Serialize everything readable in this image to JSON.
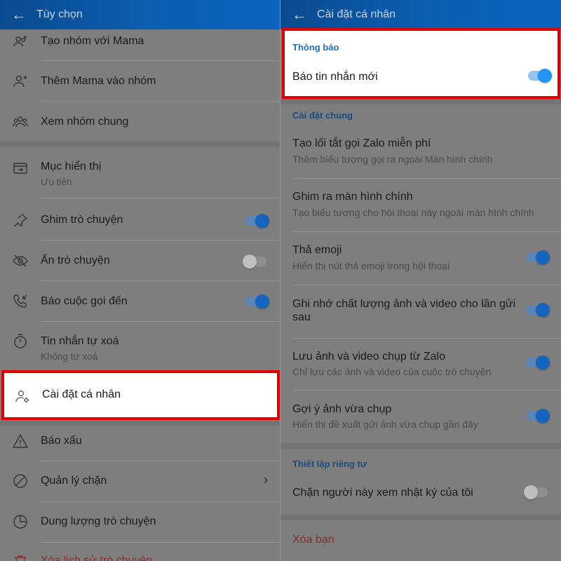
{
  "left": {
    "header": {
      "back_icon": "arrow-left-icon",
      "title": "Tùy chọn"
    },
    "items": {
      "create_group": {
        "label": "Tạo nhóm với Mama",
        "icon": "group-add-icon"
      },
      "add_to_group": {
        "label": "Thêm Mama vào nhóm",
        "icon": "person-add-icon"
      },
      "common_groups": {
        "label": "Xem nhóm chung",
        "icon": "group-icon"
      },
      "display_category": {
        "label": "Mục hiển thị",
        "sub": "Ưu tiên",
        "icon": "folder-arrow-icon"
      },
      "pin_chat": {
        "label": "Ghim trò chuyện",
        "icon": "pin-icon",
        "toggle": true
      },
      "hide_chat": {
        "label": "Ẩn trò chuyện",
        "icon": "eye-off-icon",
        "toggle": false
      },
      "incoming_call": {
        "label": "Báo cuộc gọi đến",
        "icon": "phone-incoming-icon",
        "toggle": true
      },
      "self_delete": {
        "label": "Tin nhắn tự xoá",
        "sub": "Không tự xoá",
        "icon": "timer-icon"
      },
      "personal_settings": {
        "label": "Cài đặt cá nhân",
        "icon": "user-settings-icon"
      },
      "report": {
        "label": "Báo xấu",
        "icon": "warning-icon"
      },
      "block_manage": {
        "label": "Quản lý chặn",
        "icon": "block-icon"
      },
      "storage": {
        "label": "Dung lượng trò chuyện",
        "icon": "pie-chart-icon"
      },
      "clear_history": {
        "label": "Xóa lịch sử trò chuyện",
        "icon": "trash-icon"
      }
    }
  },
  "right": {
    "header": {
      "back_icon": "arrow-left-icon",
      "title": "Cài đặt cá nhân"
    },
    "notifications": {
      "section": "Thông báo",
      "new_message": {
        "label": "Báo tin nhắn mới",
        "toggle": true
      }
    },
    "general": {
      "section": "Cài đặt chung",
      "shortcut": {
        "label": "Tạo lối tắt gọi Zalo miễn phí",
        "sub": "Thêm biểu tượng gọi ra ngoài Màn hình chính"
      },
      "pin_home": {
        "label": "Ghim ra màn hình chính",
        "sub": "Tạo biểu tượng cho hội thoại này ngoài màn hình chính"
      },
      "emoji": {
        "label": "Thả emoji",
        "sub": "Hiển thị nút thả emoji trong hội thoại",
        "toggle": true
      },
      "remember_quality": {
        "label": "Ghi nhớ chất lượng ảnh và video cho lần gửi sau",
        "toggle": true
      },
      "save_media": {
        "label": "Lưu ảnh và video chụp từ Zalo",
        "sub": "Chỉ lưu các ảnh và video của cuộc trò chuyện",
        "toggle": true
      },
      "suggest_photos": {
        "label": "Gợi ý ảnh vừa chụp",
        "sub": "Hiển thị đề xuất gửi ảnh vừa chụp gần đây",
        "toggle": true
      }
    },
    "privacy": {
      "section": "Thiết lập riêng tư",
      "block_diary": {
        "label": "Chặn người này xem nhật ký của tôi",
        "toggle": false
      }
    },
    "delete_friend": {
      "label": "Xóa bạn"
    }
  }
}
